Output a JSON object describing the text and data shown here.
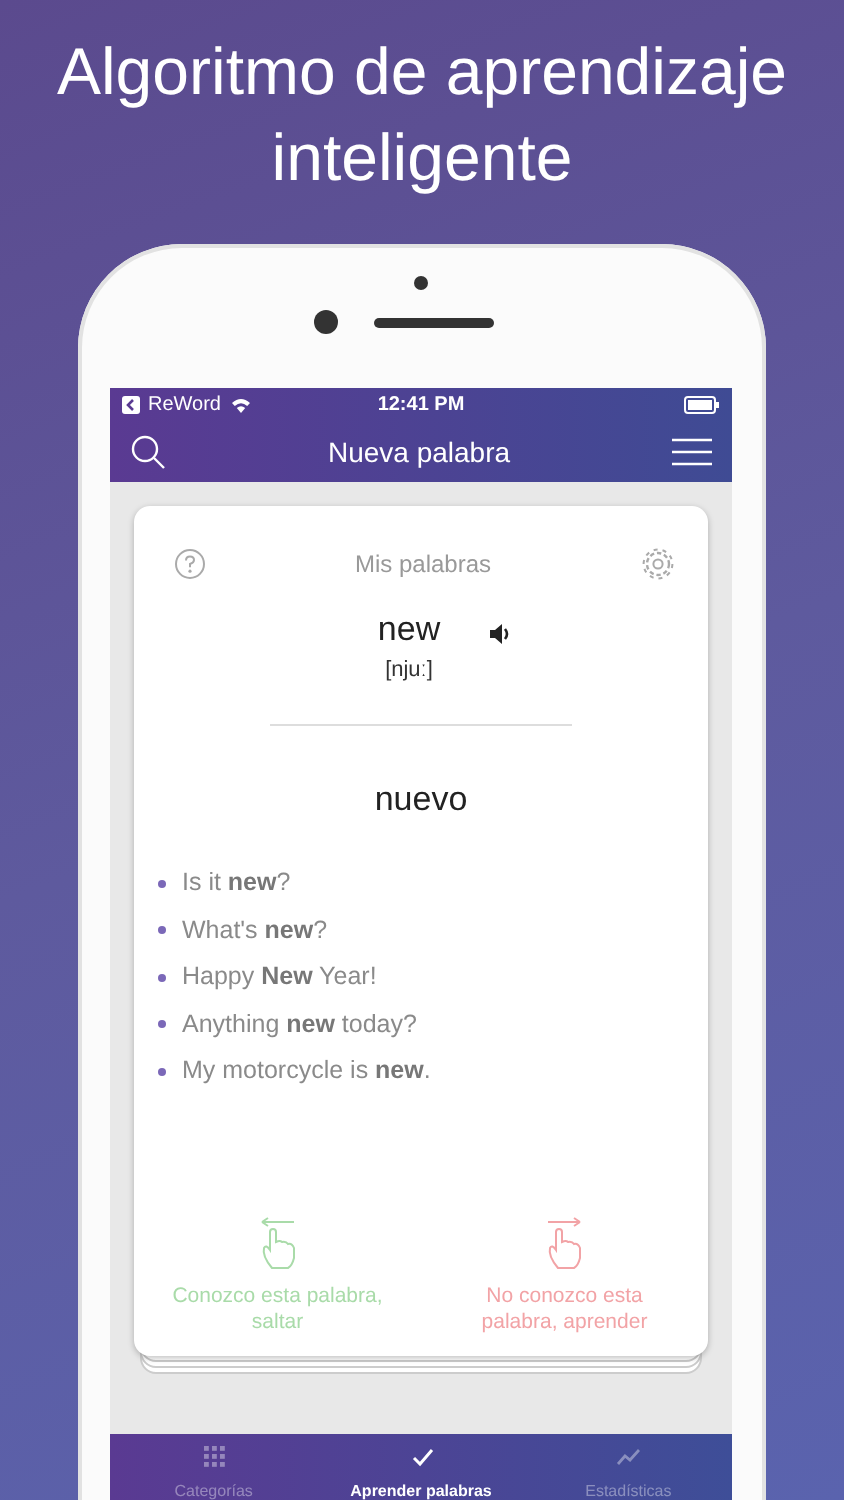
{
  "headline": "Algoritmo de aprendizaje inteligente",
  "status_bar": {
    "back_app": "ReWord",
    "time": "12:41 PM"
  },
  "nav": {
    "title": "Nueva palabra"
  },
  "card": {
    "deck": "Mis palabras",
    "word": "new",
    "transcription": "[njuː]",
    "translation": "nuevo",
    "examples": [
      "Is it **new**?",
      "What's **new**?",
      "Happy **New** Year!",
      "Anything **new** today?",
      "My motorcycle is **new**."
    ],
    "actions": [
      {
        "kind": "know",
        "label": "Conozco esta palabra, saltar"
      },
      {
        "kind": "learn",
        "label": "No conozco esta palabra, aprender"
      }
    ]
  },
  "tabs": [
    {
      "kind": "grid",
      "label": "Categorías",
      "selected": false
    },
    {
      "kind": "check",
      "label": "Aprender palabras",
      "selected": true
    },
    {
      "kind": "chart",
      "label": "Estadísticas",
      "selected": false
    }
  ]
}
